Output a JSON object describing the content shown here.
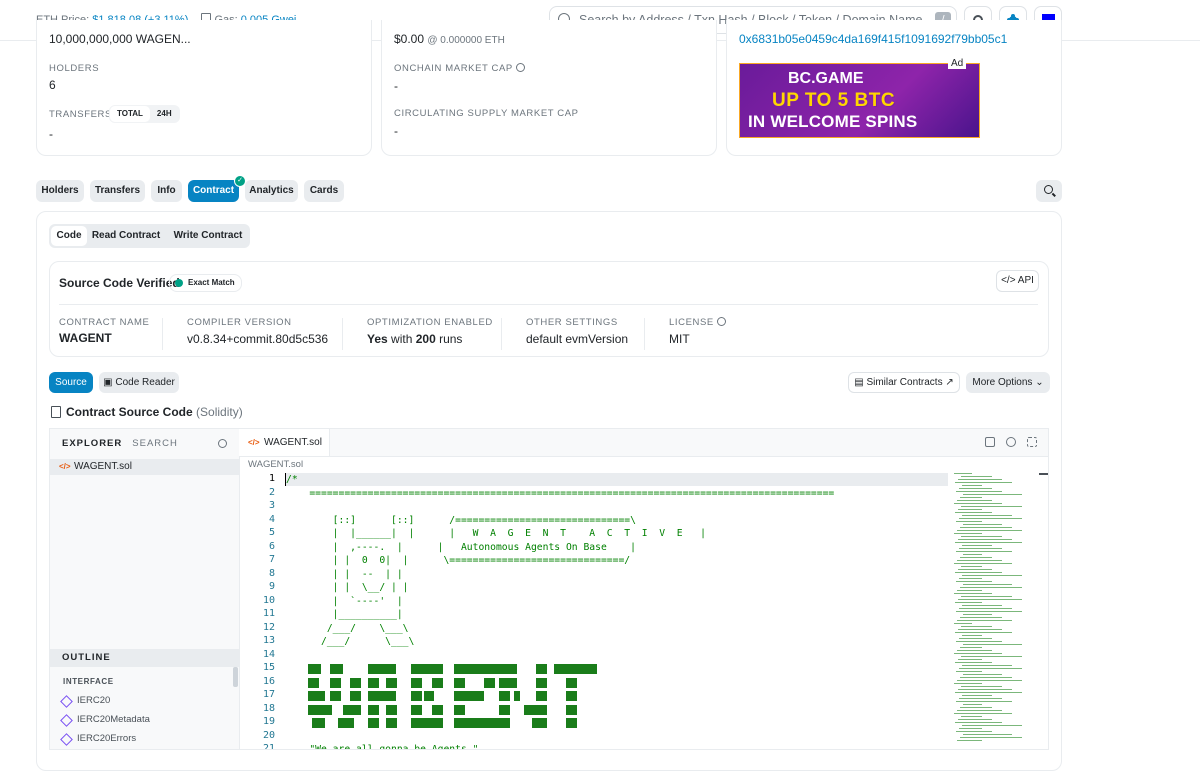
{
  "topbar": {
    "eth_price_label": "ETH Price:",
    "eth_price_value": "$1,818.08",
    "eth_price_change": "(+3.11%)",
    "gas_label": "Gas:",
    "gas_value": "0.005 Gwei",
    "search_placeholder": "Search by Address / Txn Hash / Block / Token / Domain Name",
    "search_shortcut": "/"
  },
  "overview": {
    "supply_cut": "10,000,000,000 WAGEN...",
    "holders_label": "HOLDERS",
    "holders_value": "6",
    "transfers_label": "TRANSFERS",
    "transfers_toggle": [
      "TOTAL",
      "24H"
    ],
    "transfers_value": "-"
  },
  "market": {
    "price_cut": "$0.00",
    "price_eth_cut": "@ 0.000000 ETH",
    "onchain_label": "ONCHAIN MARKET CAP",
    "onchain_value": "-",
    "circ_label": "CIRCULATING SUPPLY MARKET CAP",
    "circ_value": "-"
  },
  "other_info": {
    "address_cut": "0x6831b05e0459c4da169f415f1091692f79bb05c1",
    "ad_badge": "Ad",
    "ad_line1": "BC.GAME",
    "ad_line2": "UP TO 5 BTC",
    "ad_line3": "IN WELCOME SPINS"
  },
  "tabs": [
    "Holders",
    "Transfers",
    "Info",
    "Contract",
    "Analytics",
    "Cards"
  ],
  "subtabs": [
    "Code",
    "Read Contract",
    "Write Contract"
  ],
  "verified": {
    "title": "Source Code Verified",
    "badge": "Exact Match",
    "api": "API",
    "fields": [
      {
        "label": "CONTRACT NAME",
        "value": "WAGENT"
      },
      {
        "label": "COMPILER VERSION",
        "value": "v0.8.34+commit.80d5c536"
      },
      {
        "label": "OPTIMIZATION ENABLED",
        "value_pre": "Yes",
        "value_mid": " with ",
        "value_num": "200",
        "value_post": " runs"
      },
      {
        "label": "OTHER SETTINGS",
        "value": "default evmVersion"
      },
      {
        "label": "LICENSE",
        "value": "MIT"
      }
    ]
  },
  "source_bar": {
    "source_btn": "Source",
    "reader_btn": "Code Reader",
    "similar_btn": "Similar Contracts",
    "more_btn": "More Options",
    "title": "Contract Source Code",
    "title_lang": "(Solidity)"
  },
  "editor": {
    "explorer_label": "EXPLORER",
    "search_label": "SEARCH",
    "file_name": "WAGENT.sol",
    "tab_name": "WAGENT.sol",
    "breadcrumb": "WAGENT.sol",
    "outline_label": "OUTLINE",
    "interface_label": "INTERFACE",
    "interfaces": [
      "IERC20",
      "IERC20Metadata",
      "IERC20Errors"
    ],
    "line_numbers": [
      "1",
      "2",
      "3",
      "4",
      "5",
      "6",
      "7",
      "8",
      "9",
      "10",
      "11",
      "12",
      "13",
      "14",
      "15",
      "16",
      "17",
      "18",
      "19",
      "20",
      "21"
    ],
    "code_lines": [
      "/*",
      "    ==========================================================================================",
      "",
      "        [::]      [::]      /==============================\\",
      "        |  |______|  |      |   W  A  G  E  N  T    A  C  T  I  V  E   |",
      "        |  ,----.  |      |   Autonomous Agents On Base    |",
      "        | |  0  0|  |      \\==============================/",
      "        | |  --  | |",
      "        | |  \\__/ | |",
      "        |  `----'  |",
      "        |__________|",
      "       /___/    \\___\\",
      "      /___/      \\___\\",
      "",
      "",
      "",
      "",
      "",
      "",
      "",
      "    \"We are all gonna be Agents.\""
    ]
  }
}
